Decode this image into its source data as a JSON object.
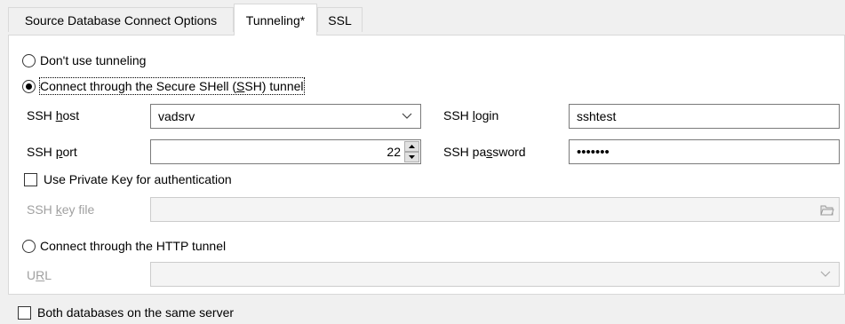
{
  "tabs": [
    {
      "label": "Source Database Connect Options"
    },
    {
      "label": "Tunneling*"
    },
    {
      "label": "SSL"
    }
  ],
  "tunneling": {
    "no_tunnel_label": "Don't use tunneling",
    "ssh_option": {
      "prefix": "Connect through the Secure SHell (",
      "underlined": "S",
      "suffix": "SH) tunnel"
    },
    "ssh_host": {
      "prefix": "SSH ",
      "underlined": "h",
      "suffix": "ost",
      "value": "vadsrv"
    },
    "ssh_login": {
      "prefix": "SSH ",
      "underlined": "l",
      "suffix": "ogin",
      "value": "sshtest"
    },
    "ssh_port": {
      "prefix": "SSH ",
      "underlined": "p",
      "suffix": "ort",
      "value": "22"
    },
    "ssh_password": {
      "prefix": "SSH pa",
      "underlined": "s",
      "suffix": "sword",
      "value": "•••••••"
    },
    "private_key_label": "Use Private Key for authentication",
    "ssh_key_file": {
      "prefix": "SSH ",
      "underlined": "k",
      "suffix": "ey file",
      "value": ""
    },
    "http_option_label": "Connect through the HTTP tunnel",
    "url": {
      "prefix": "U",
      "underlined": "R",
      "suffix": "L",
      "value": ""
    }
  },
  "footer": {
    "same_server_label": "Both databases on the same server"
  },
  "state": {
    "selected_tunnel": "ssh",
    "use_private_key": false,
    "same_server": false
  }
}
